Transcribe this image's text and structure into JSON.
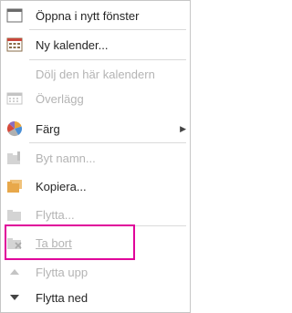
{
  "menu": {
    "items": [
      {
        "key": "open_new_window",
        "label": "Öppna i nytt fönster",
        "disabled": false,
        "icon": "new-window-icon"
      },
      {
        "key": "new_calendar",
        "label": "Ny kalender...",
        "disabled": false,
        "icon": "calendar-icon"
      },
      {
        "key": "hide_calendar",
        "label": "Dölj den här kalendern",
        "disabled": true,
        "icon": ""
      },
      {
        "key": "overlay",
        "label": "Överlägg",
        "disabled": true,
        "icon": "overlay-icon"
      },
      {
        "key": "color",
        "label": "Färg",
        "disabled": false,
        "icon": "color-wheel-icon",
        "submenu": true
      },
      {
        "key": "rename",
        "label": "Byt namn...",
        "disabled": true,
        "icon": "rename-icon"
      },
      {
        "key": "copy",
        "label": "Kopiera...",
        "disabled": false,
        "icon": "copy-icon"
      },
      {
        "key": "move",
        "label": "Flytta...",
        "disabled": true,
        "icon": "move-icon"
      },
      {
        "key": "delete",
        "label": "Ta bort",
        "disabled": true,
        "icon": "delete-calendar-icon",
        "highlighted": true
      },
      {
        "key": "move_up",
        "label": "Flytta upp",
        "disabled": true,
        "icon": "move-up-icon"
      },
      {
        "key": "move_down",
        "label": "Flytta ned",
        "disabled": false,
        "icon": "move-down-icon"
      }
    ]
  },
  "colors": {
    "text": "#262626",
    "disabled_text": "#b4b4b4",
    "highlight": "#e0009a"
  }
}
